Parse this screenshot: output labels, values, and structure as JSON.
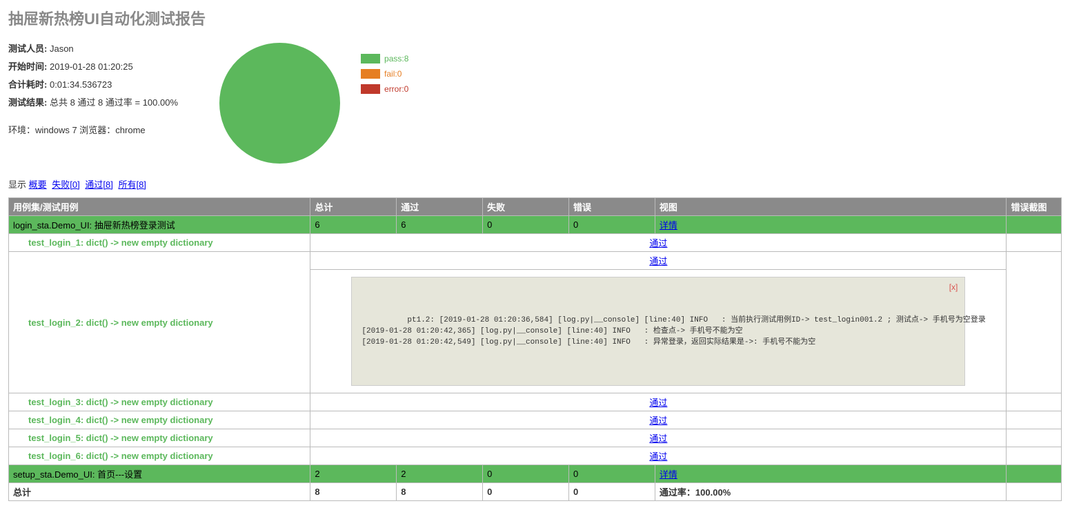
{
  "title": "抽屉新热榜UI自动化测试报告",
  "meta": {
    "tester_label": "测试人员:",
    "tester": "Jason",
    "start_label": "开始时间:",
    "start": "2019-01-28 01:20:25",
    "duration_label": "合计耗时:",
    "duration": "0:01:34.536723",
    "result_label": "测试结果:",
    "result": "总共 8 通过 8 通过率 = 100.00%",
    "env": "环境：windows 7 浏览器：chrome"
  },
  "chart_data": {
    "type": "pie",
    "series": [
      {
        "name": "pass",
        "value": 8,
        "color": "#5cb85c"
      },
      {
        "name": "fail",
        "value": 0,
        "color": "#e67e22"
      },
      {
        "name": "error",
        "value": 0,
        "color": "#c0392b"
      }
    ]
  },
  "legend": {
    "pass": "pass:8",
    "fail": "fail:0",
    "error": "error:0"
  },
  "filters": {
    "label": "显示",
    "summary": "概要",
    "failed": "失败[0]",
    "passed": "通过[8]",
    "all": "所有[8]"
  },
  "columns": {
    "name": "用例集/测试用例",
    "total": "总计",
    "pass": "通过",
    "fail": "失败",
    "error": "错误",
    "view": "视图",
    "screenshot": "错误截图"
  },
  "suite1": {
    "name": "login_sta.Demo_UI: 抽屉新热榜登录测试",
    "total": "6",
    "pass": "6",
    "fail": "0",
    "error": "0",
    "view": "详情"
  },
  "cases1": {
    "c1": "test_login_1: dict() -> new empty dictionary",
    "c2": "test_login_2: dict() -> new empty dictionary",
    "c3": "test_login_3: dict() -> new empty dictionary",
    "c4": "test_login_4: dict() -> new empty dictionary",
    "c5": "test_login_5: dict() -> new empty dictionary",
    "c6": "test_login_6: dict() -> new empty dictionary"
  },
  "pass_label": "通过",
  "log": {
    "close": "[x]",
    "line1": "pt1.2: [2019-01-28 01:20:36,584] [log.py|__console] [line:40] INFO   : 当前执行测试用例ID-> test_login001.2 ; 测试点-> 手机号为空登录",
    "line2": "[2019-01-28 01:20:42,365] [log.py|__console] [line:40] INFO   : 检查点-> 手机号不能为空",
    "line3": "[2019-01-28 01:20:42,549] [log.py|__console] [line:40] INFO   : 异常登录，返回实际结果是->: 手机号不能为空"
  },
  "suite2": {
    "name": "setup_sta.Demo_UI: 首页---设置",
    "total": "2",
    "pass": "2",
    "fail": "0",
    "error": "0",
    "view": "详情"
  },
  "totals": {
    "label": "总计",
    "total": "8",
    "pass": "8",
    "fail": "0",
    "error": "0",
    "rate": "通过率：100.00%"
  }
}
